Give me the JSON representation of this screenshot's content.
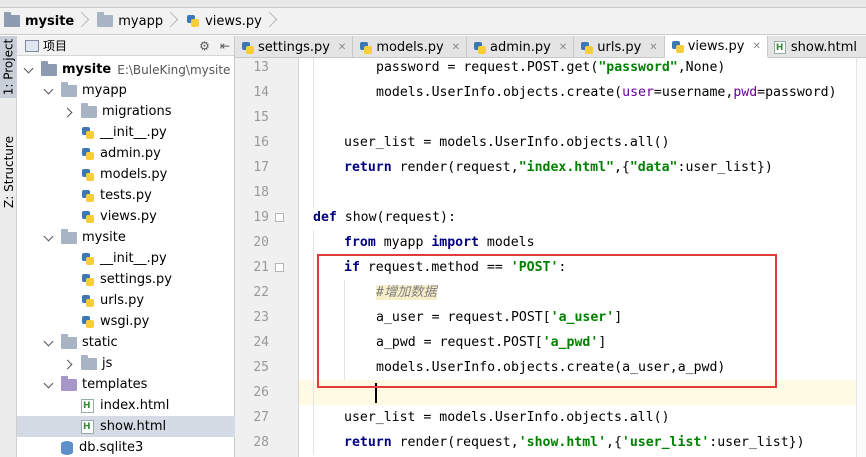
{
  "breadcrumb": [
    {
      "label": "mysite",
      "icon": "folder-icon",
      "bold": true
    },
    {
      "label": "myapp",
      "icon": "folder-icon",
      "bold": false
    },
    {
      "label": "views.py",
      "icon": "python-file-icon",
      "bold": false
    }
  ],
  "side_strip": {
    "project_tab": "1: Project",
    "structure_tab": "Z: Structure"
  },
  "project_panel": {
    "header_label": "项目",
    "header_icons": [
      "settings-icon",
      "collapse-icon"
    ],
    "tree": [
      {
        "label": "mysite",
        "path": "E:\\BuleKing\\mysite",
        "type": "folder",
        "expanded": true,
        "bold": true
      },
      {
        "label": "myapp",
        "type": "folder",
        "expanded": true
      },
      {
        "label": "migrations",
        "type": "folder",
        "expanded": false
      },
      {
        "label": "__init__.py",
        "type": "python"
      },
      {
        "label": "admin.py",
        "type": "python"
      },
      {
        "label": "models.py",
        "type": "python"
      },
      {
        "label": "tests.py",
        "type": "python"
      },
      {
        "label": "views.py",
        "type": "python"
      },
      {
        "label": "mysite",
        "type": "folder",
        "expanded": true
      },
      {
        "label": "__init__.py",
        "type": "python"
      },
      {
        "label": "settings.py",
        "type": "python"
      },
      {
        "label": "urls.py",
        "type": "python"
      },
      {
        "label": "wsgi.py",
        "type": "python"
      },
      {
        "label": "static",
        "type": "folder",
        "expanded": true
      },
      {
        "label": "js",
        "type": "folder",
        "expanded": false
      },
      {
        "label": "templates",
        "type": "folder-purple",
        "expanded": true
      },
      {
        "label": "index.html",
        "type": "html"
      },
      {
        "label": "show.html",
        "type": "html",
        "selected": true
      },
      {
        "label": "db.sqlite3",
        "type": "db"
      }
    ]
  },
  "editor_tabs": [
    {
      "label": "settings.py",
      "type": "python",
      "active": false
    },
    {
      "label": "models.py",
      "type": "python",
      "active": false
    },
    {
      "label": "admin.py",
      "type": "python",
      "active": false
    },
    {
      "label": "urls.py",
      "type": "python",
      "active": false
    },
    {
      "label": "views.py",
      "type": "python",
      "active": true
    },
    {
      "label": "show.html",
      "type": "html",
      "active": false
    }
  ],
  "code_lines": [
    {
      "num": "13",
      "indent": 2,
      "tokens": [
        [
          "",
          "password = request.POST.get("
        ],
        [
          "str",
          "\"password\""
        ],
        [
          "",
          ",None)"
        ]
      ]
    },
    {
      "num": "14",
      "indent": 2,
      "tokens": [
        [
          "",
          "models.UserInfo.objects.create("
        ],
        [
          "kwarg",
          "user"
        ],
        [
          "",
          "=username,"
        ],
        [
          "kwarg",
          "pwd"
        ],
        [
          "",
          "=password)"
        ]
      ]
    },
    {
      "num": "15",
      "indent": 0,
      "tokens": []
    },
    {
      "num": "16",
      "indent": 1,
      "tokens": [
        [
          "",
          "user_list = models.UserInfo.objects.all()"
        ]
      ]
    },
    {
      "num": "17",
      "indent": 1,
      "tokens": [
        [
          "kw",
          "return"
        ],
        [
          "",
          " render(request,"
        ],
        [
          "str",
          "\"index.html\""
        ],
        [
          "",
          ",{"
        ],
        [
          "str",
          "\"data\""
        ],
        [
          "",
          ":user_list})"
        ]
      ]
    },
    {
      "num": "18",
      "indent": 0,
      "tokens": []
    },
    {
      "num": "19",
      "indent": 0,
      "tokens": [
        [
          "kw",
          "def"
        ],
        [
          "",
          " show(request):"
        ]
      ]
    },
    {
      "num": "20",
      "indent": 1,
      "tokens": [
        [
          "kw",
          "from"
        ],
        [
          "",
          " myapp "
        ],
        [
          "kw",
          "import"
        ],
        [
          "",
          " models"
        ]
      ]
    },
    {
      "num": "21",
      "indent": 1,
      "tokens": [
        [
          "kw",
          "if"
        ],
        [
          "",
          " request.method == "
        ],
        [
          "str",
          "'POST'"
        ],
        [
          "",
          ":"
        ]
      ]
    },
    {
      "num": "22",
      "indent": 2,
      "tokens": [
        [
          "cmt",
          "#增加数据"
        ]
      ]
    },
    {
      "num": "23",
      "indent": 2,
      "tokens": [
        [
          "",
          "a_user = request.POST["
        ],
        [
          "str",
          "'a_user'"
        ],
        [
          "",
          "]"
        ]
      ]
    },
    {
      "num": "24",
      "indent": 2,
      "tokens": [
        [
          "",
          "a_pwd = request.POST["
        ],
        [
          "str",
          "'a_pwd'"
        ],
        [
          "",
          "]"
        ]
      ]
    },
    {
      "num": "25",
      "indent": 2,
      "tokens": [
        [
          "",
          "models.UserInfo.objects.create(a_user,a_pwd)"
        ]
      ]
    },
    {
      "num": "26",
      "indent": 0,
      "tokens": [],
      "current": true
    },
    {
      "num": "27",
      "indent": 1,
      "tokens": [
        [
          "",
          "user_list = models.UserInfo.objects.all()"
        ]
      ]
    },
    {
      "num": "28",
      "indent": 1,
      "tokens": [
        [
          "kw",
          "return"
        ],
        [
          "",
          " render(request,"
        ],
        [
          "str",
          "'show.html'"
        ],
        [
          "",
          ",{"
        ],
        [
          "str",
          "'user_list'"
        ],
        [
          "",
          ":user_list})"
        ]
      ]
    }
  ],
  "colors": {
    "keyword": "#000080",
    "string": "#008000",
    "kwarg": "#660099",
    "comment": "#808080",
    "highlight_box": "#e23b3b",
    "current_line": "#fffae3"
  }
}
